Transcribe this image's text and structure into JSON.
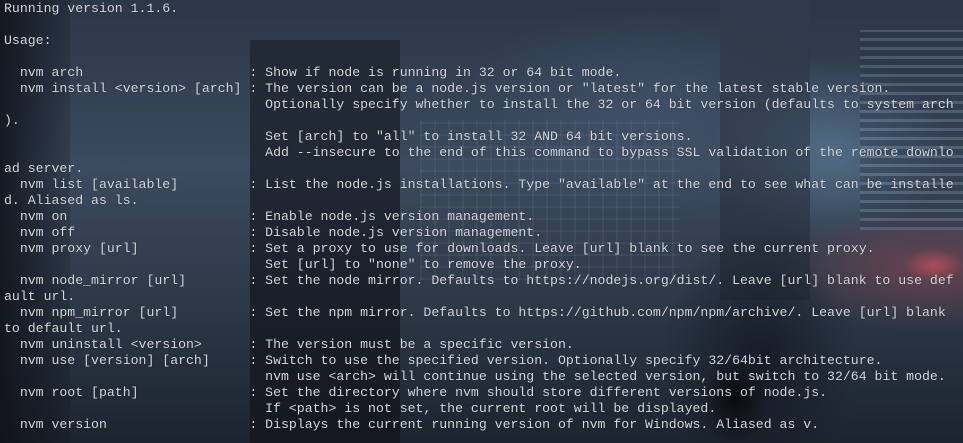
{
  "terminal": {
    "lines": [
      "Running version 1.1.6.",
      "",
      "Usage:",
      "",
      "  nvm arch                     : Show if node is running in 32 or 64 bit mode.",
      "  nvm install <version> [arch] : The version can be a node.js version or \"latest\" for the latest stable version.",
      "                                 Optionally specify whether to install the 32 or 64 bit version (defaults to system arch",
      ").",
      "                                 Set [arch] to \"all\" to install 32 AND 64 bit versions.",
      "                                 Add --insecure to the end of this command to bypass SSL validation of the remote downlo",
      "ad server.",
      "  nvm list [available]         : List the node.js installations. Type \"available\" at the end to see what can be installe",
      "d. Aliased as ls.",
      "  nvm on                       : Enable node.js version management.",
      "  nvm off                      : Disable node.js version management.",
      "  nvm proxy [url]              : Set a proxy to use for downloads. Leave [url] blank to see the current proxy.",
      "                                 Set [url] to \"none\" to remove the proxy.",
      "  nvm node_mirror [url]        : Set the node mirror. Defaults to https://nodejs.org/dist/. Leave [url] blank to use def",
      "ault url.",
      "  nvm npm_mirror [url]         : Set the npm mirror. Defaults to https://github.com/npm/npm/archive/. Leave [url] blank",
      "to default url.",
      "  nvm uninstall <version>      : The version must be a specific version.",
      "  nvm use [version] [arch]     : Switch to use the specified version. Optionally specify 32/64bit architecture.",
      "                                 nvm use <arch> will continue using the selected version, but switch to 32/64 bit mode.",
      "  nvm root [path]              : Set the directory where nvm should store different versions of node.js.",
      "                                 If <path> is not set, the current root will be displayed.",
      "  nvm version                  : Displays the current running version of nvm for Windows. Aliased as v."
    ]
  }
}
